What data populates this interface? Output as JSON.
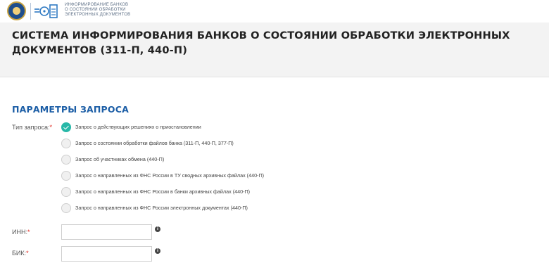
{
  "header": {
    "logo_lines": [
      "ИНФОРМИРОВАНИЕ БАНКОВ",
      "О СОСТОЯНИИ ОБРАБОТКИ",
      "ЭЛЕКТРОННЫХ ДОКУМЕНТОВ"
    ],
    "system_title": "СИСТЕМА ИНФОРМИРОВАНИЯ БАНКОВ О СОСТОЯНИИ ОБРАБОТКИ ЭЛЕКТРОННЫХ ДОКУМЕНТОВ (311-П, 440-П)"
  },
  "form": {
    "section_title": "ПАРАМЕТРЫ ЗАПРОСА",
    "required_mark": "*",
    "request_type": {
      "label": "Тип запроса:",
      "selected_index": 0,
      "options": [
        "Запрос о действующих решениях о приостановлении",
        "Запрос о состоянии обработки файлов банка (311-П, 440-П, 377-П)",
        "Запрос об участниках обмена (440-П)",
        "Запрос о направленных из ФНС России в ТУ сводных архивных файлах (440-П)",
        "Запрос о направленных из ФНС России в банки архивных файлах (440-П)",
        "Запрос о направленных из ФНС России электронных документах (440-П)"
      ]
    },
    "inn": {
      "label": "ИНН:",
      "value": ""
    },
    "bik": {
      "label": "БИК:",
      "value": ""
    }
  }
}
